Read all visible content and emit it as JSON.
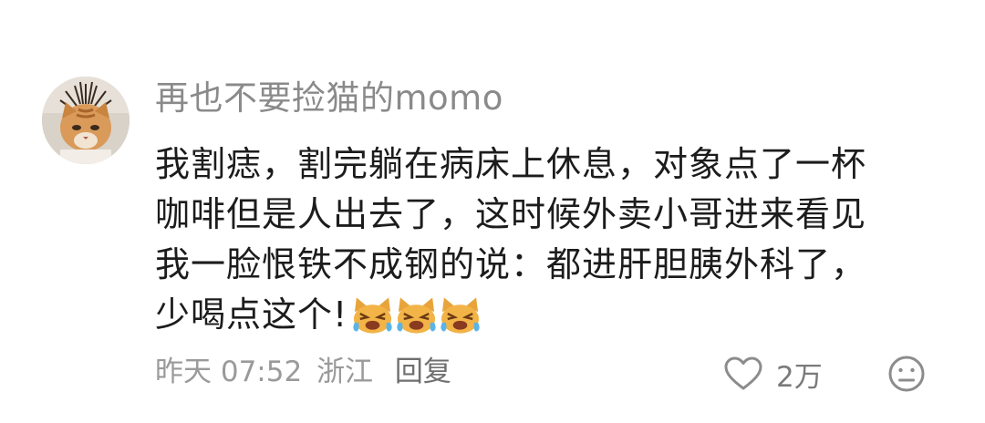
{
  "comment": {
    "username": "再也不要捡猫的momo",
    "content_lines": [
      "我割痣，割完躺在病床上休息，对象点了一杯",
      "咖啡但是人出去了，这时候外卖小哥进来看见",
      "我一脸恨铁不成钢的说：都进肝胆胰外科了，",
      "少喝点这个!"
    ],
    "emojis": [
      "crying-cat-emoji",
      "crying-cat-emoji",
      "crying-cat-emoji"
    ],
    "timestamp": "昨天 07:52",
    "location": "浙江",
    "reply_label": "回复",
    "like_count": "2万"
  },
  "colors": {
    "username": "#8a8a8a",
    "content": "#1c1c1c",
    "meta": "#9a9a9a",
    "icon": "#8c8c8c"
  }
}
